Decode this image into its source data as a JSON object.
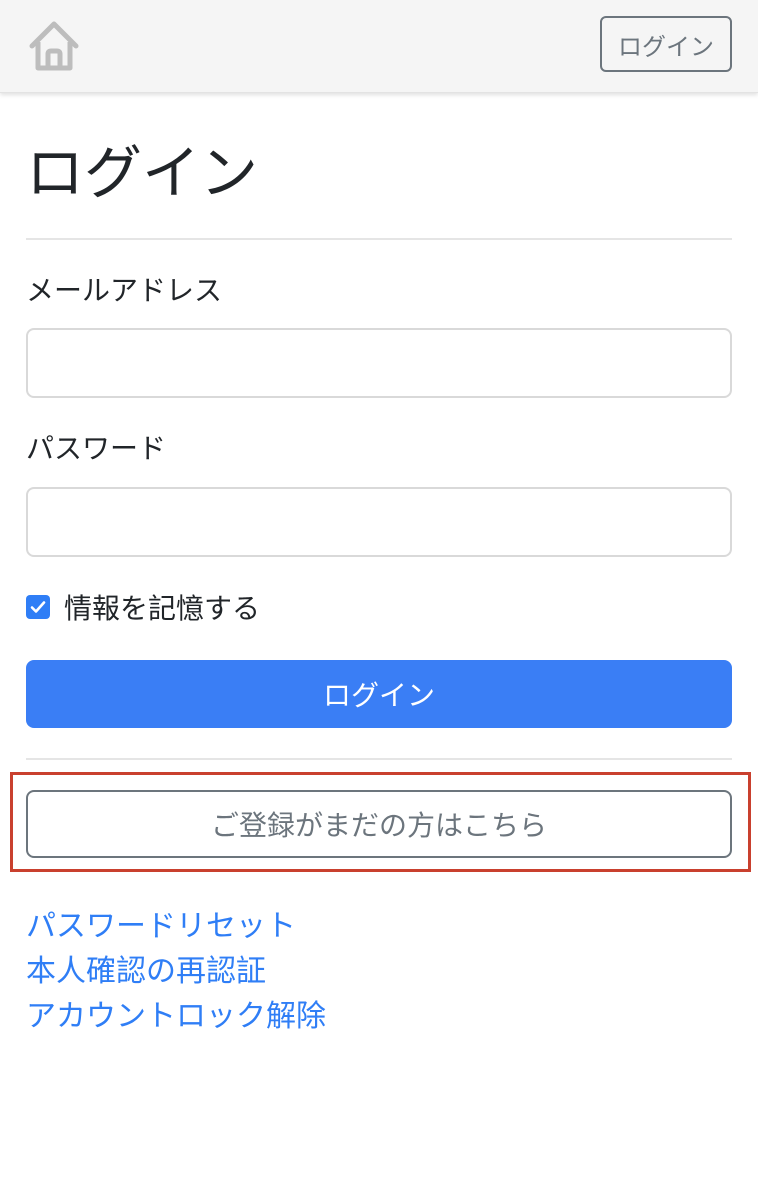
{
  "navbar": {
    "home_icon": "home-icon",
    "login_button": "ログイン"
  },
  "page": {
    "title": "ログイン"
  },
  "form": {
    "email_label": "メールアドレス",
    "email_value": "",
    "password_label": "パスワード",
    "password_value": "",
    "remember_label": "情報を記憶する",
    "remember_checked": true,
    "submit_label": "ログイン",
    "register_label": "ご登録がまだの方はこちら"
  },
  "links": [
    "パスワードリセット",
    "本人確認の再認証",
    "アカウントロック解除"
  ],
  "colors": {
    "primary": "#3a7ef5",
    "link": "#2f7ef6",
    "highlight": "#c9402e",
    "secondary": "#6c757d"
  }
}
